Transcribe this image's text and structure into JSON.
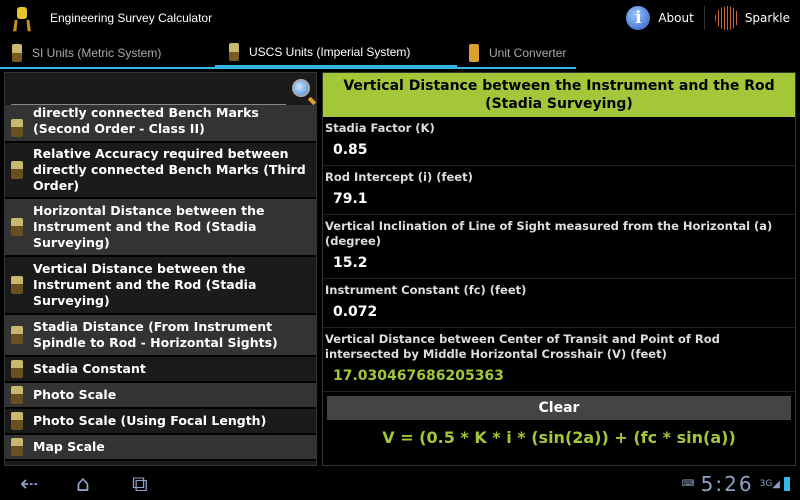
{
  "app": {
    "title": "Engineering Survey Calculator",
    "about": "About",
    "sparkle": "Sparkle"
  },
  "tabs": [
    {
      "label": "SI Units (Metric System)"
    },
    {
      "label": "USCS Units (Imperial System)"
    },
    {
      "label": "Unit Converter"
    }
  ],
  "search": {
    "placeholder": ""
  },
  "list": [
    "directly connected Bench Marks (Second Order - Class II)",
    "Relative Accuracy required between directly connected Bench Marks (Third Order)",
    "Horizontal Distance between the Instrument and the Rod (Stadia Surveying)",
    "Vertical Distance between the Instrument and the Rod (Stadia Surveying)",
    "Stadia Distance (From Instrument Spindle to Rod - Horizontal Sights)",
    "Stadia Constant",
    "Photo Scale",
    "Photo Scale (Using Focal Length)",
    "Map Scale"
  ],
  "panel": {
    "title": "Vertical Distance between the Instrument and the Rod (Stadia Surveying)",
    "fields": [
      {
        "label": "Stadia Factor (K)",
        "value": "0.85"
      },
      {
        "label": "Rod Intercept (i) (feet)",
        "value": "79.1"
      },
      {
        "label": "Vertical Inclination of Line of Sight measured from the Horizontal (a) (degree)",
        "value": "15.2"
      },
      {
        "label": "Instrument Constant (fc) (feet)",
        "value": "0.072"
      }
    ],
    "result": {
      "label": "Vertical Distance between Center of Transit and Point of Rod intersected by Middle Horizontal Crosshair (V) (feet)",
      "value": "17.030467686205363"
    },
    "clear": "Clear",
    "formula": "V = (0.5 * K * i * (sin(2a)) + (fc * sin(a))"
  },
  "status": {
    "time": "5:26",
    "network": "3G"
  },
  "colors": {
    "accent": "#a4c639",
    "tab": "#33b5e5"
  }
}
